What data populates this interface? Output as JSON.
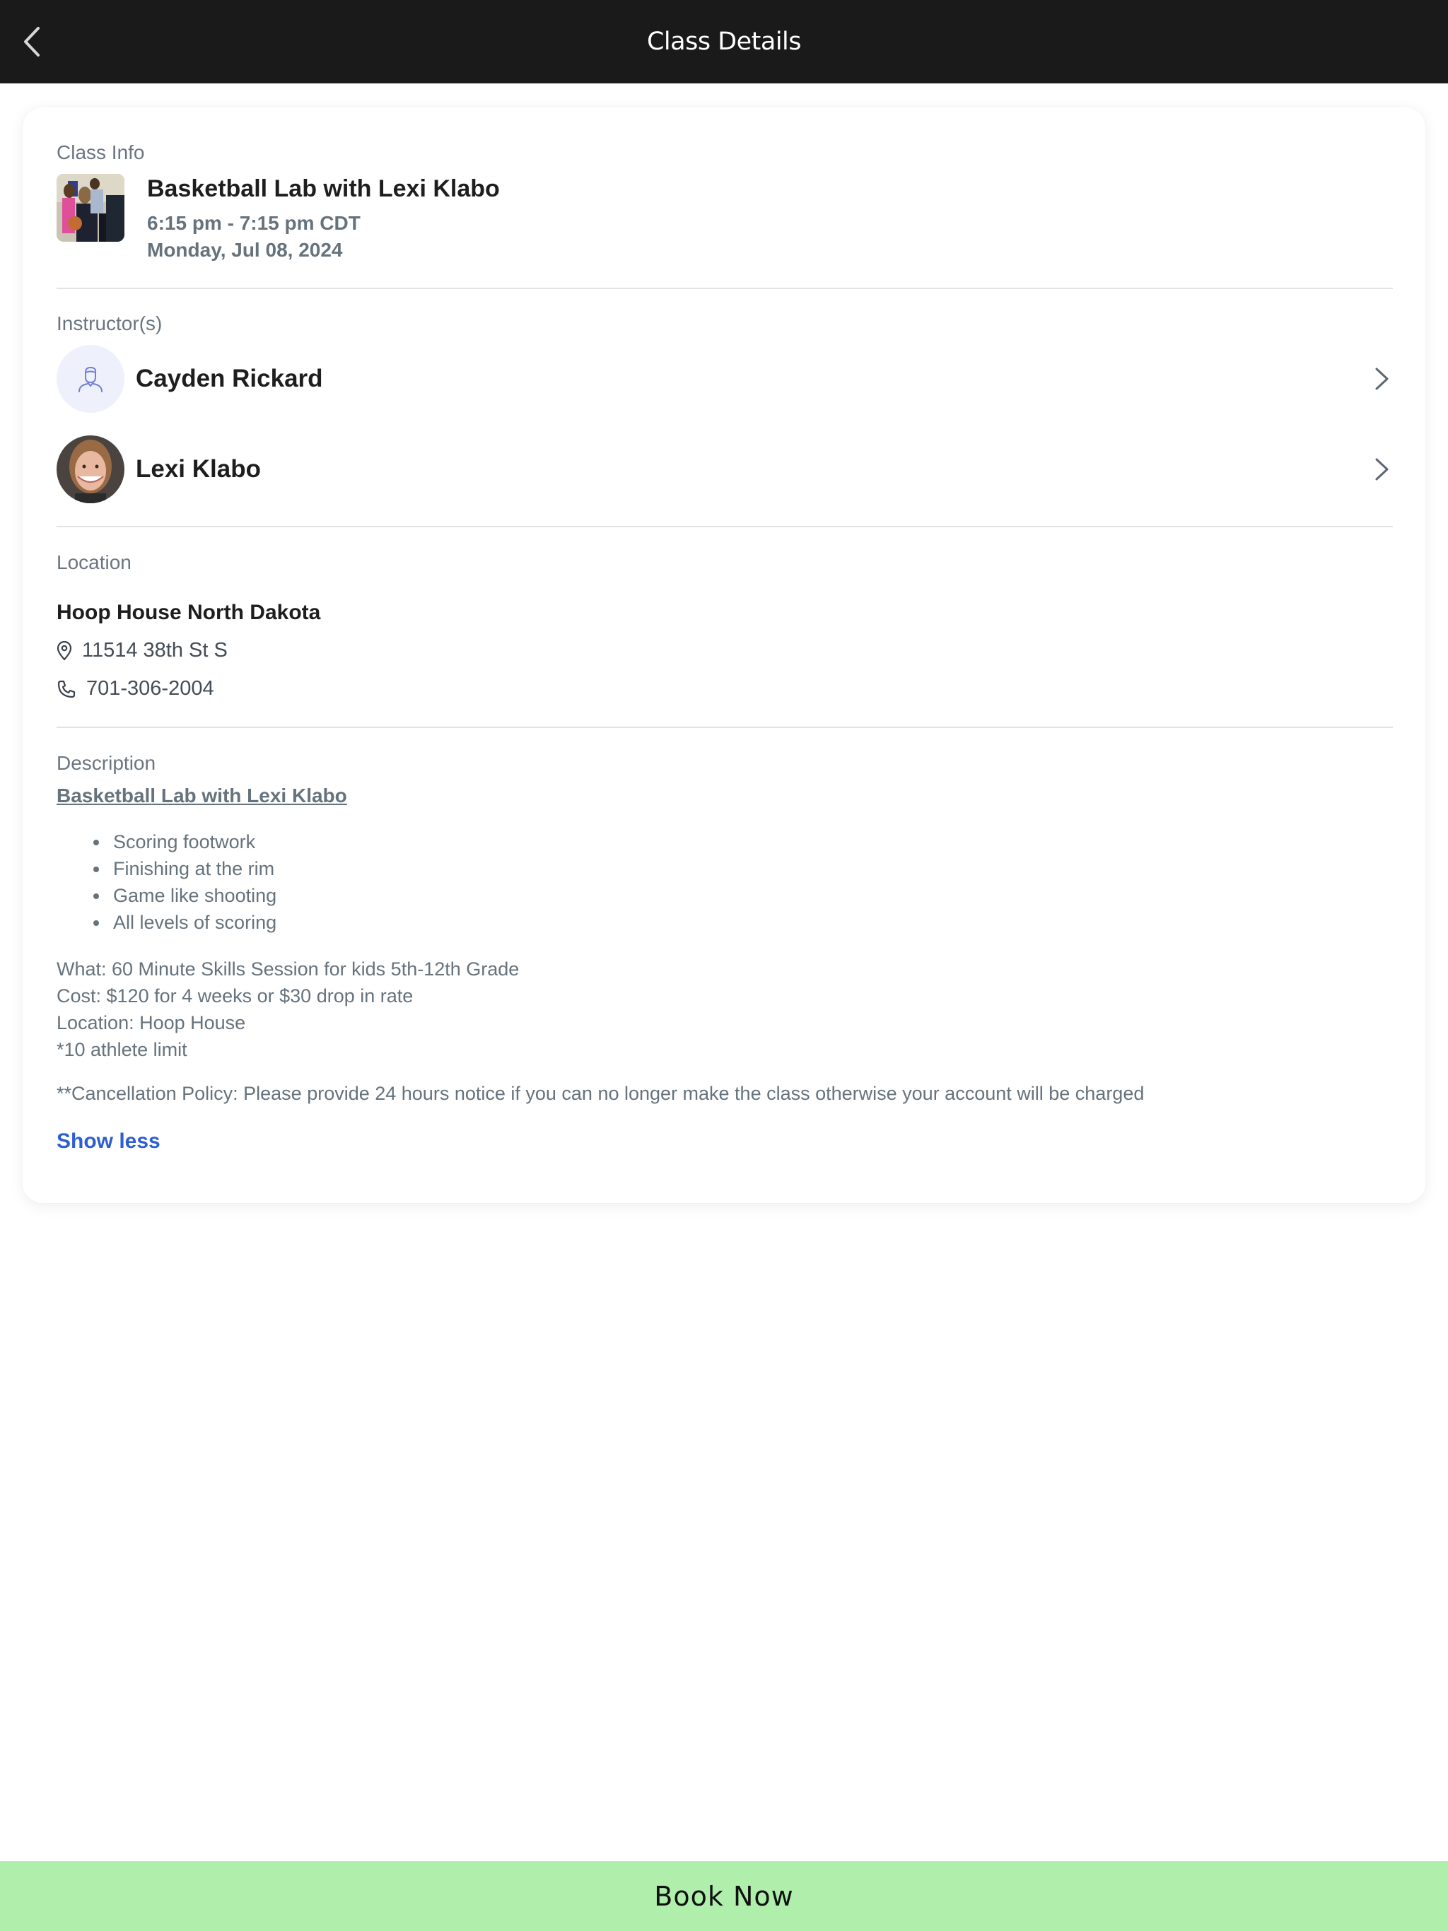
{
  "header": {
    "title": "Class Details",
    "back_icon": "chevron-left-icon"
  },
  "class_info": {
    "section_label": "Class Info",
    "title": "Basketball Lab with Lexi Klabo",
    "time": "6:15 pm - 7:15 pm CDT",
    "date": "Monday, Jul 08, 2024",
    "thumbnail": "class-photo"
  },
  "instructors": {
    "section_label": "Instructor(s)",
    "items": [
      {
        "name": "Cayden Rickard",
        "avatar": "placeholder-person-icon"
      },
      {
        "name": "Lexi Klabo",
        "avatar": "photo"
      }
    ]
  },
  "location": {
    "section_label": "Location",
    "name": "Hoop House North Dakota",
    "address": "11514 38th St S",
    "phone": "701-306-2004"
  },
  "description": {
    "section_label": "Description",
    "title_link": "Basketball Lab with Lexi Klabo",
    "bullets": [
      "Scoring footwork",
      "Finishing at the rim",
      "Game like shooting",
      "All levels of scoring"
    ],
    "lines": [
      "What: 60 Minute Skills Session for kids 5th-12th Grade",
      "Cost: $120 for 4 weeks or $30 drop in rate",
      "Location: Hoop House",
      "*10 athlete limit"
    ],
    "cancellation_policy": "**Cancellation Policy: Please provide 24 hours notice if you can no longer make the class otherwise your account will be charged",
    "toggle_label": "Show less"
  },
  "footer": {
    "book_label": "Book Now"
  },
  "colors": {
    "header_bg": "#1a1a1a",
    "link_blue": "#2d5fd0",
    "book_button_bg": "#b0eeab",
    "muted_text": "#66727c",
    "avatar_placeholder_bg": "#eef0fb",
    "avatar_icon": "#6f80d8"
  }
}
